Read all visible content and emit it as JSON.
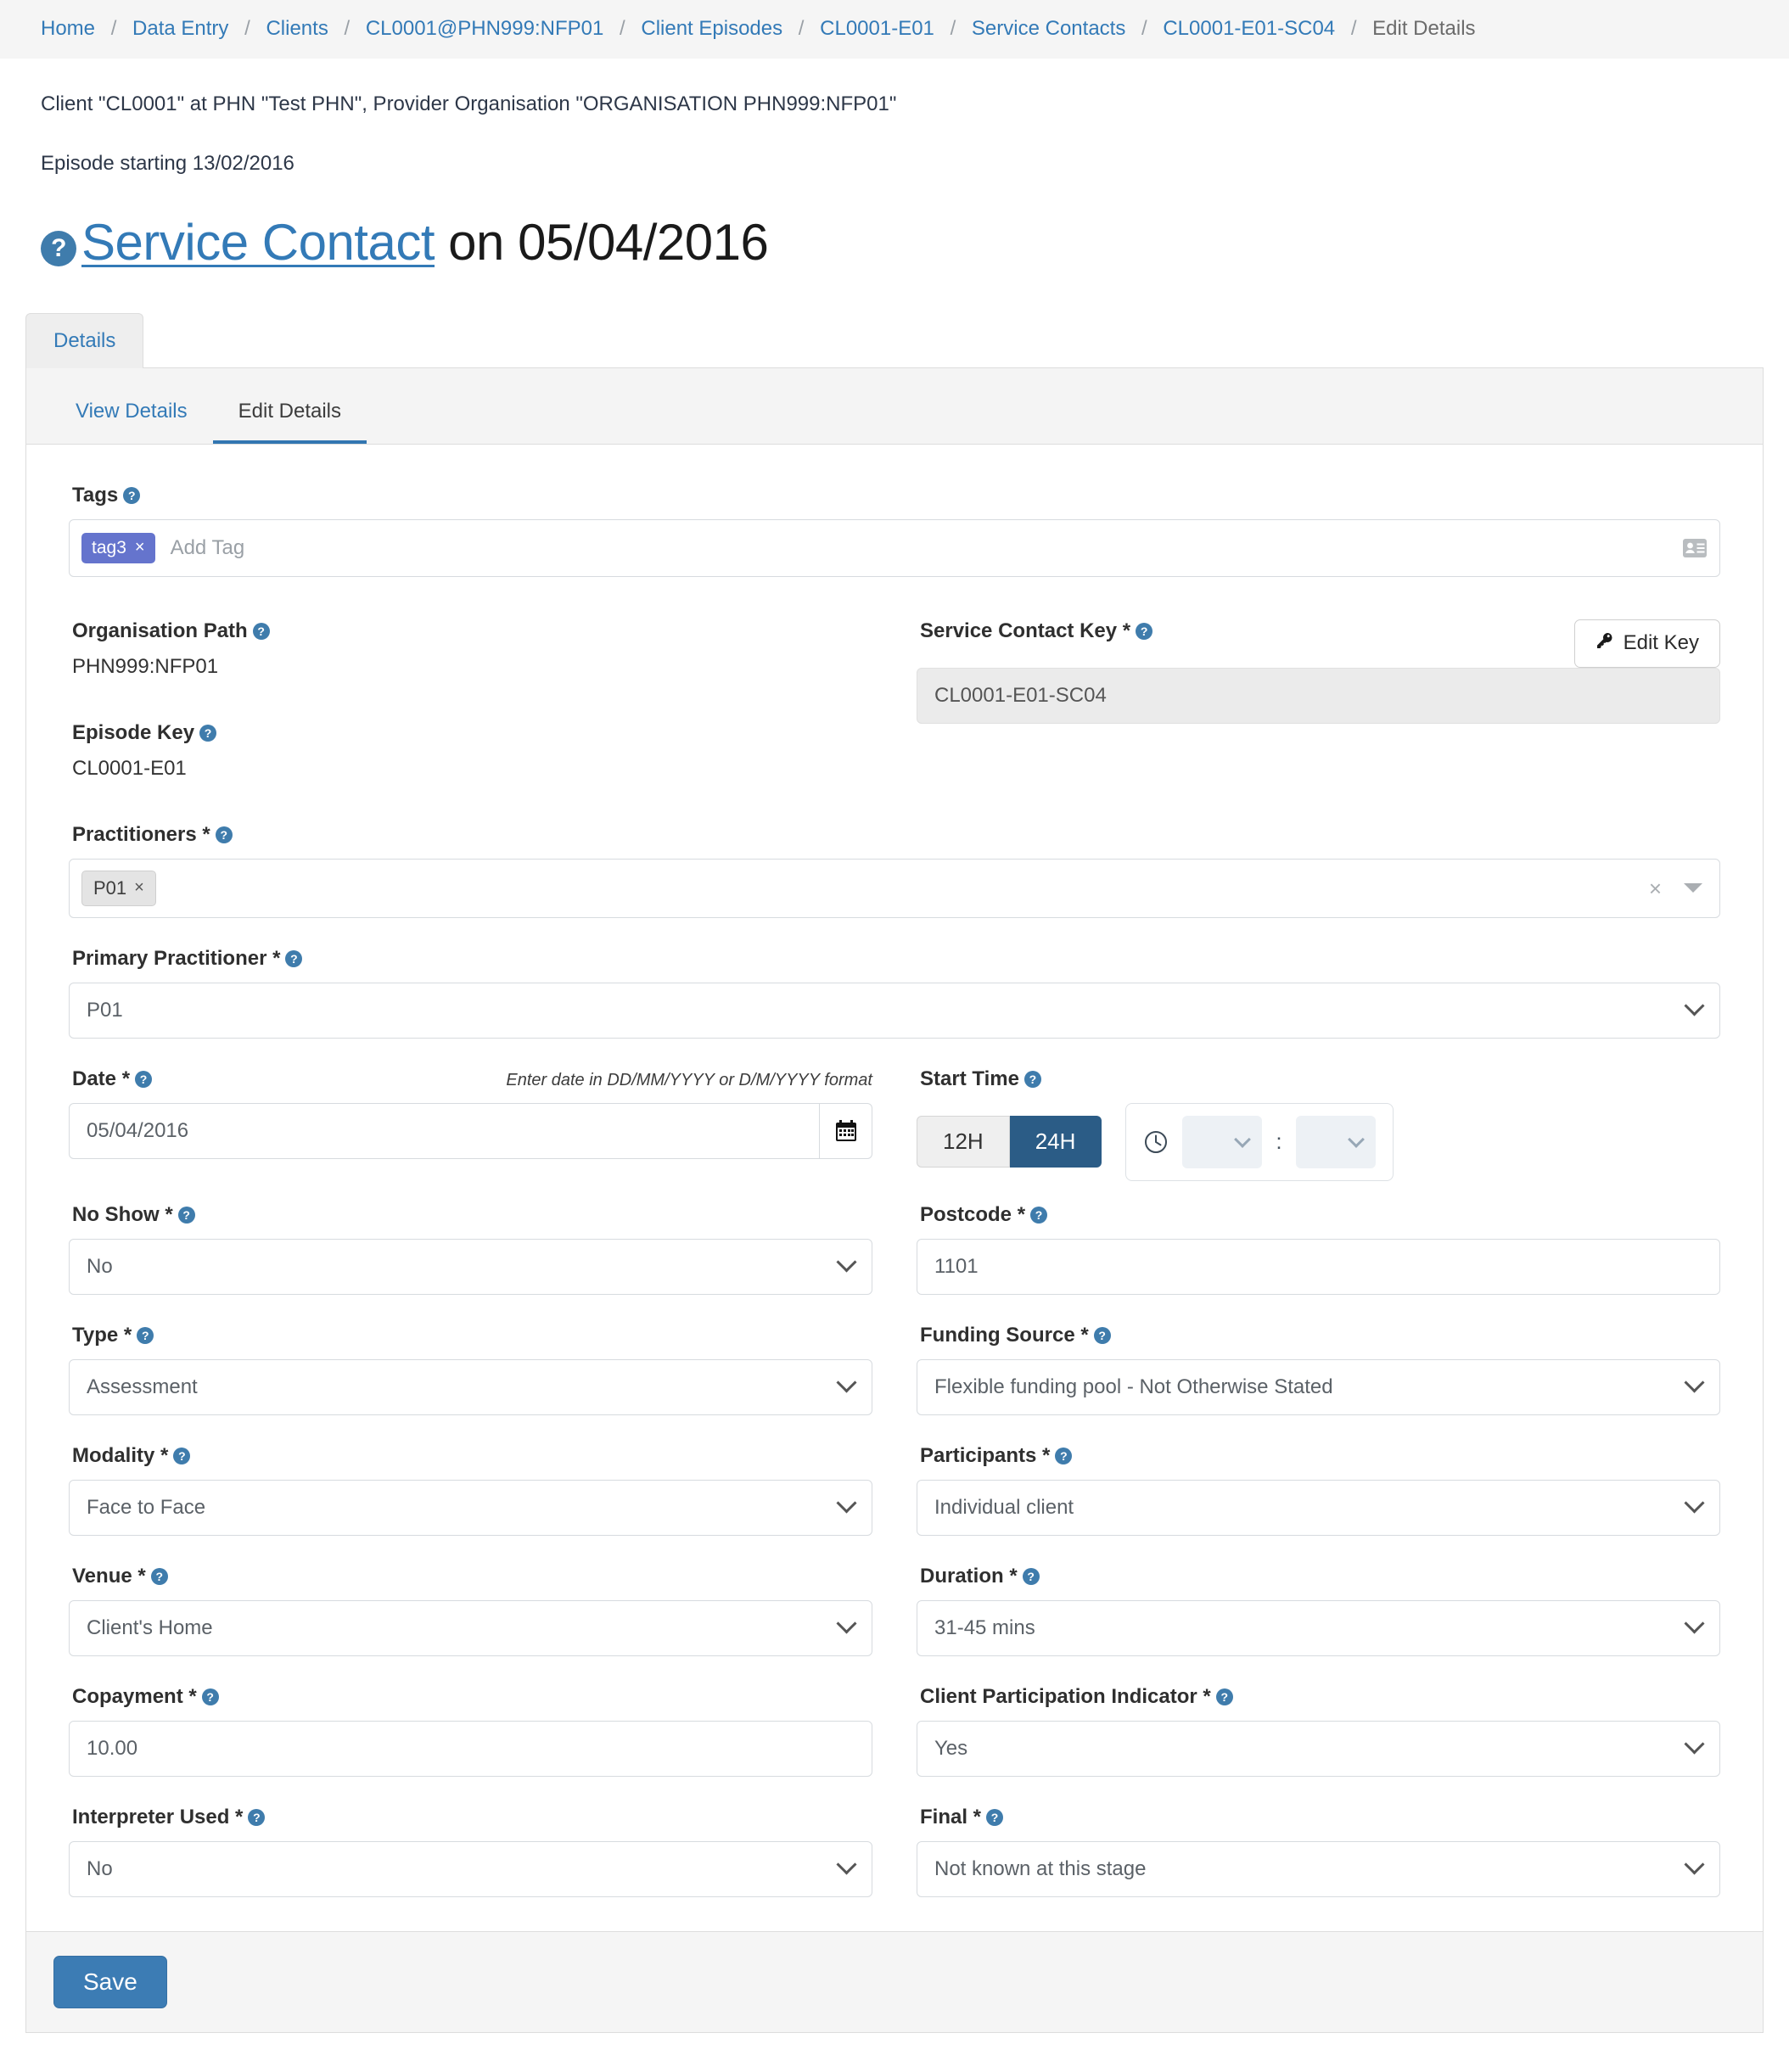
{
  "breadcrumb": {
    "items": [
      {
        "label": "Home",
        "link": true
      },
      {
        "label": "Data Entry",
        "link": true
      },
      {
        "label": "Clients",
        "link": true
      },
      {
        "label": "CL0001@PHN999:NFP01",
        "link": true
      },
      {
        "label": "Client Episodes",
        "link": true
      },
      {
        "label": "CL0001-E01",
        "link": true
      },
      {
        "label": "Service Contacts",
        "link": true
      },
      {
        "label": "CL0001-E01-SC04",
        "link": true
      },
      {
        "label": "Edit Details",
        "link": false
      }
    ],
    "separator": "/"
  },
  "context_line": "Client \"CL0001\" at PHN \"Test PHN\", Provider Organisation \"ORGANISATION PHN999:NFP01\"",
  "episode_line": "Episode starting 13/02/2016",
  "title": {
    "help": "?",
    "link_text": "Service Contact",
    "suffix": " on 05/04/2016"
  },
  "outer_tabs": [
    {
      "label": "Details",
      "active": true
    }
  ],
  "inner_tabs": [
    {
      "label": "View Details",
      "active": false
    },
    {
      "label": "Edit Details",
      "active": true
    }
  ],
  "form": {
    "tags": {
      "label": "Tags",
      "help": "?",
      "chips": [
        {
          "label": "tag3",
          "remove": "×"
        }
      ],
      "placeholder": "Add Tag",
      "icon": "address-card-icon"
    },
    "organisation_path": {
      "label": "Organisation Path",
      "help": "?",
      "value": "PHN999:NFP01"
    },
    "episode_key": {
      "label": "Episode Key",
      "help": "?",
      "value": "CL0001-E01"
    },
    "service_contact_key": {
      "label": "Service Contact Key *",
      "help": "?",
      "value": "CL0001-E01-SC04",
      "edit_key_button": "Edit Key"
    },
    "practitioners": {
      "label": "Practitioners *",
      "help": "?",
      "chips": [
        {
          "label": "P01",
          "remove": "×"
        }
      ],
      "clear": "×"
    },
    "primary_practitioner": {
      "label": "Primary Practitioner *",
      "help": "?",
      "value": "P01"
    },
    "date": {
      "label": "Date *",
      "help": "?",
      "hint": "Enter date in DD/MM/YYYY or D/M/YYYY format",
      "value": "05/04/2016",
      "icon": "calendar-icon"
    },
    "start_time": {
      "label": "Start Time",
      "help": "?",
      "format_options": [
        {
          "label": "12H",
          "active": false
        },
        {
          "label": "24H",
          "active": true
        }
      ],
      "hours": "",
      "minutes": "",
      "separator": ":",
      "icon": "clock-icon"
    },
    "no_show": {
      "label": "No Show *",
      "help": "?",
      "value": "No"
    },
    "postcode": {
      "label": "Postcode *",
      "help": "?",
      "value": "1101"
    },
    "type": {
      "label": "Type *",
      "help": "?",
      "value": "Assessment"
    },
    "funding_source": {
      "label": "Funding Source *",
      "help": "?",
      "value": "Flexible funding pool - Not Otherwise Stated"
    },
    "modality": {
      "label": "Modality *",
      "help": "?",
      "value": "Face to Face"
    },
    "participants": {
      "label": "Participants *",
      "help": "?",
      "value": "Individual client"
    },
    "venue": {
      "label": "Venue *",
      "help": "?",
      "value": "Client's Home"
    },
    "duration": {
      "label": "Duration *",
      "help": "?",
      "value": "31-45 mins"
    },
    "copayment": {
      "label": "Copayment *",
      "help": "?",
      "value": "10.00"
    },
    "client_participation_indicator": {
      "label": "Client Participation Indicator *",
      "help": "?",
      "value": "Yes"
    },
    "interpreter_used": {
      "label": "Interpreter Used *",
      "help": "?",
      "value": "No"
    },
    "final": {
      "label": "Final *",
      "help": "?",
      "value": "Not known at this stage"
    }
  },
  "footer": {
    "save_label": "Save"
  },
  "colors": {
    "link": "#337ab7",
    "tag_chip": "#6574cd",
    "active_toggle": "#2b5c86",
    "save_button": "#3c7cb4",
    "help_badge": "#3f7cac"
  }
}
